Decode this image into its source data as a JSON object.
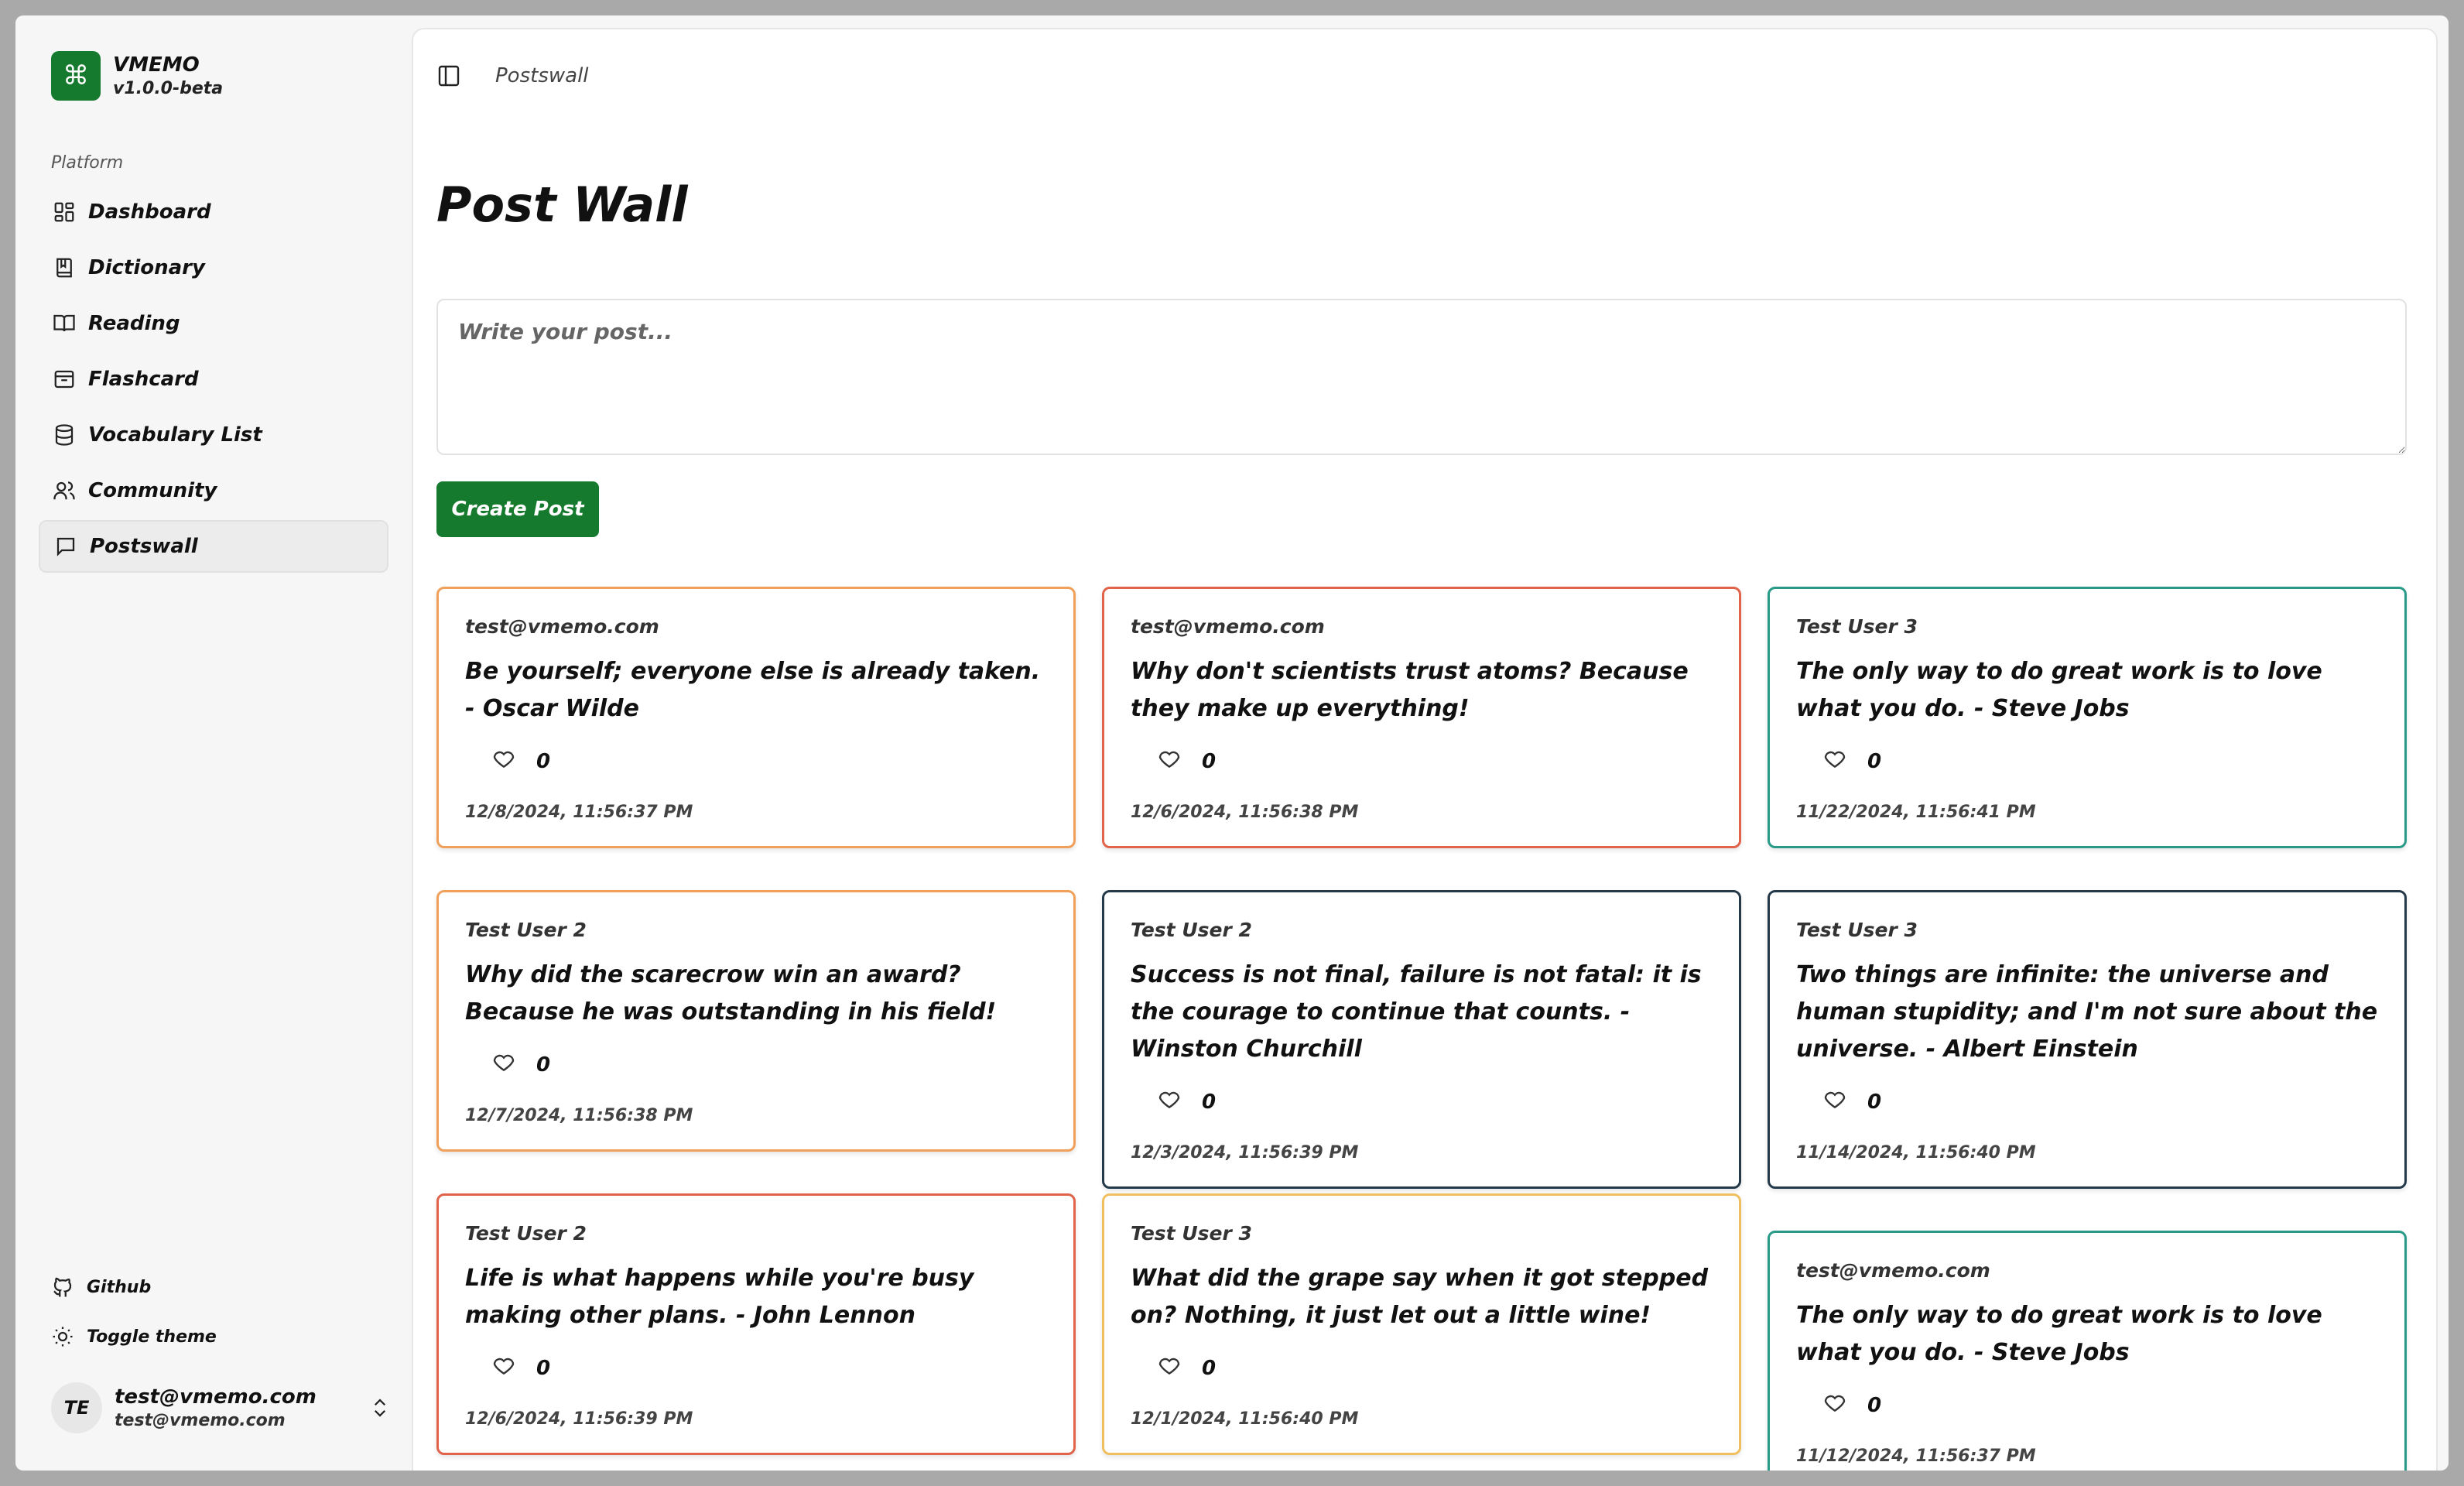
{
  "brand": {
    "name": "VMEMO",
    "version": "v1.0.0-beta",
    "logo_icon": "command-icon",
    "accent": "#167a2e"
  },
  "sidebar": {
    "section_label": "Platform",
    "items": [
      {
        "label": "Dashboard",
        "icon": "dashboard-icon"
      },
      {
        "label": "Dictionary",
        "icon": "book-icon"
      },
      {
        "label": "Reading",
        "icon": "open-book-icon"
      },
      {
        "label": "Flashcard",
        "icon": "inbox-icon"
      },
      {
        "label": "Vocabulary List",
        "icon": "database-icon"
      },
      {
        "label": "Community",
        "icon": "users-icon"
      },
      {
        "label": "Postswall",
        "icon": "message-icon",
        "active": true
      }
    ],
    "github_label": "Github",
    "theme_label": "Toggle theme"
  },
  "user": {
    "initials": "TE",
    "name": "test@vmemo.com",
    "email": "test@vmemo.com"
  },
  "header": {
    "breadcrumb": "Postswall"
  },
  "main": {
    "title": "Post Wall",
    "input_placeholder": "Write your post...",
    "create_label": "Create Post"
  },
  "posts": [
    {
      "author": "test@vmemo.com",
      "content": "Be yourself; everyone else is already taken. - Oscar Wilde",
      "likes": "0",
      "time": "12/8/2024, 11:56:37 PM",
      "color": "#f0a05a"
    },
    {
      "author": "test@vmemo.com",
      "content": "Why don't scientists trust atoms? Because they make up everything!",
      "likes": "0",
      "time": "12/6/2024, 11:56:38 PM",
      "color": "#e0634a"
    },
    {
      "author": "Test User 3",
      "content": "The only way to do great work is to love what you do. - Steve Jobs",
      "likes": "0",
      "time": "11/22/2024, 11:56:41 PM",
      "color": "#2a9a88"
    },
    {
      "author": "Test User 2",
      "content": "Why did the scarecrow win an award? Because he was outstanding in his field!",
      "likes": "0",
      "time": "12/7/2024, 11:56:38 PM",
      "color": "#f0a05a"
    },
    {
      "author": "Test User 2",
      "content": "Success is not final, failure is not fatal: it is the courage to continue that counts. - Winston Churchill",
      "likes": "0",
      "time": "12/3/2024, 11:56:39 PM",
      "color": "#243a4a"
    },
    {
      "author": "Test User 3",
      "content": "Two things are infinite: the universe and human stupidity; and I'm not sure about the universe. - Albert Einstein",
      "likes": "0",
      "time": "11/14/2024, 11:56:40 PM",
      "color": "#243a4a"
    },
    {
      "author": "Test User 2",
      "content": "Life is what happens while you're busy making other plans. - John Lennon",
      "likes": "0",
      "time": "12/6/2024, 11:56:39 PM",
      "color": "#e0634a"
    },
    {
      "author": "Test User 3",
      "content": "What did the grape say when it got stepped on? Nothing, it just let out a little wine!",
      "likes": "0",
      "time": "12/1/2024, 11:56:40 PM",
      "color": "#f0c060"
    },
    {
      "author": "test@vmemo.com",
      "content": "The only way to do great work is to love what you do. - Steve Jobs",
      "likes": "0",
      "time": "11/12/2024, 11:56:37 PM",
      "color": "#2a9a88"
    }
  ]
}
